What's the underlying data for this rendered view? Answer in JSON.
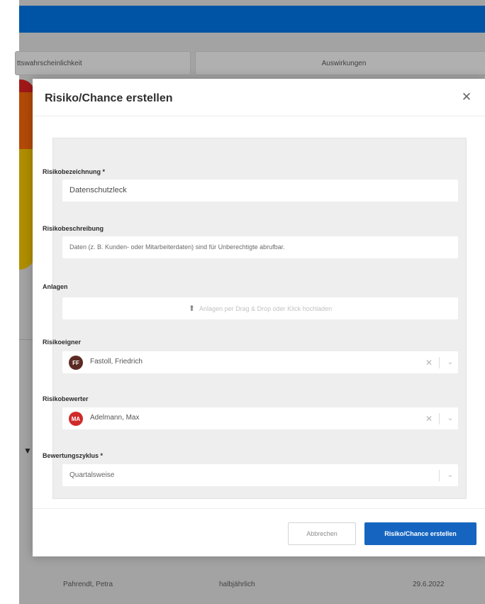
{
  "background": {
    "columns": [
      "ttswahrscheinlichkeit",
      "Auswirkungen"
    ],
    "rows": [
      {
        "name": "",
        "cycle": "",
        "date": ""
      },
      {
        "name": "Pahrendt, Petra",
        "cycle": "halbjährlich",
        "date": "29.6.2022"
      }
    ],
    "colors": {
      "topbar": "#0054a6",
      "overlay": "#a3a3a3"
    }
  },
  "modal": {
    "title": "Risiko/Chance erstellen",
    "close_icon": "close-icon"
  },
  "form": {
    "name": {
      "label": "Risikobezeichnung *",
      "value": "Datenschutzleck"
    },
    "description": {
      "label": "Risikobeschreibung",
      "value": "Daten (z. B. Kunden- oder Mitarbeiterdaten) sind für Unberechtigte abrufbar."
    },
    "attachments": {
      "label": "Anlagen",
      "placeholder": "Anlagen per Drag & Drop oder Klick hochladen",
      "icon": "upload-icon"
    },
    "owner": {
      "label": "Risikoeigner",
      "initials": "FF",
      "name": "Fastoll, Friedrich"
    },
    "evaluator": {
      "label": "Risikobewerter",
      "initials": "MA",
      "name": "Adelmann, Max"
    },
    "cycle": {
      "label": "Bewertungszyklus *",
      "value": "Quartalsweise"
    }
  },
  "footer": {
    "cancel_label": "Abbrechen",
    "submit_label": "Risiko/Chance erstellen",
    "accent": "#1565c0"
  }
}
